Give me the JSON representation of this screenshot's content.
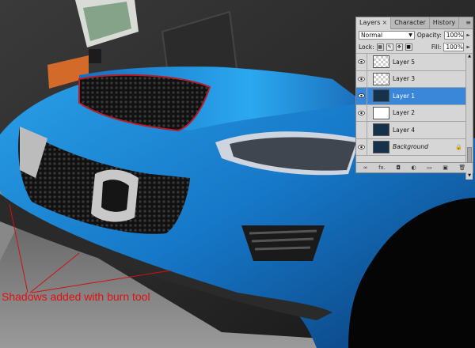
{
  "annotation": {
    "text": "Shadows added with burn tool",
    "color": "#e01010"
  },
  "layers_panel": {
    "tabs": [
      {
        "label": "Layers",
        "close": "×"
      },
      {
        "label": "Character"
      },
      {
        "label": "History"
      }
    ],
    "menu_icon": "≡",
    "blend_mode": "Normal",
    "opacity_label": "Opacity:",
    "opacity_value": "100%",
    "lock_label": "Lock:",
    "fill_label": "Fill:",
    "fill_value": "100%",
    "layers": [
      {
        "name": "Layer 5",
        "visible": true,
        "thumb": "checker",
        "selected": false
      },
      {
        "name": "Layer 3",
        "visible": true,
        "thumb": "checker",
        "selected": false
      },
      {
        "name": "Layer 1",
        "visible": true,
        "thumb": "car",
        "selected": true
      },
      {
        "name": "Layer 2",
        "visible": true,
        "thumb": "bw",
        "selected": false
      },
      {
        "name": "Layer 4",
        "visible": false,
        "thumb": "car",
        "selected": false
      },
      {
        "name": "Background",
        "visible": true,
        "thumb": "car",
        "selected": false,
        "locked": true
      }
    ],
    "bottom_icons": [
      "link-icon",
      "fx-icon",
      "mask-icon",
      "adjustment-icon",
      "group-icon",
      "new-layer-icon",
      "trash-icon"
    ],
    "bottom_glyphs": [
      "∞",
      "fx.",
      "◘",
      "◐",
      "▭",
      "▣",
      "🗑"
    ],
    "accent": "#3a87d9"
  }
}
